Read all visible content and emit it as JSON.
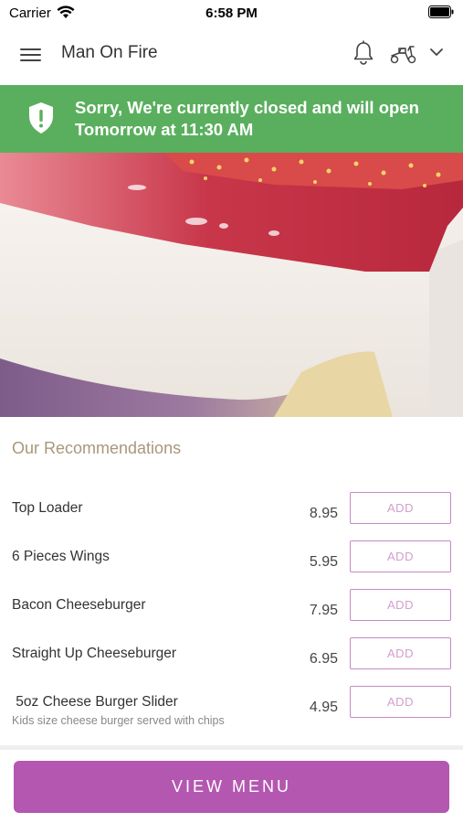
{
  "status_bar": {
    "carrier": "Carrier",
    "time": "6:58 PM",
    "icons": [
      "wifi-icon",
      "battery-icon"
    ]
  },
  "header": {
    "title": "Man On Fire",
    "icons": [
      "menu-icon",
      "bell-icon",
      "scooter-icon",
      "chevron-down-icon"
    ]
  },
  "banner": {
    "icon": "shield-alert-icon",
    "text": "Sorry, We're currently closed and will open Tomorrow at 11:30 AM",
    "color": "#5aaf5e"
  },
  "hero": {
    "image": "strawberry-cheesecake-photo"
  },
  "recommendations": {
    "title": "Our Recommendations",
    "items": [
      {
        "name": "Top Loader",
        "description": "",
        "price": "8.95",
        "add_label": "ADD"
      },
      {
        "name": "6 Pieces Wings",
        "description": "",
        "price": "5.95",
        "add_label": "ADD"
      },
      {
        "name": "Bacon Cheeseburger",
        "description": "",
        "price": "7.95",
        "add_label": "ADD"
      },
      {
        "name": "Straight Up Cheeseburger",
        "description": "",
        "price": "6.95",
        "add_label": "ADD"
      },
      {
        "name": " 5oz Cheese Burger Slider",
        "description": "Kids size cheese burger served with chips",
        "price": "4.95",
        "add_label": "ADD"
      }
    ]
  },
  "footer": {
    "view_menu_label": "VIEW MENU",
    "accent_color": "#b457b0"
  }
}
